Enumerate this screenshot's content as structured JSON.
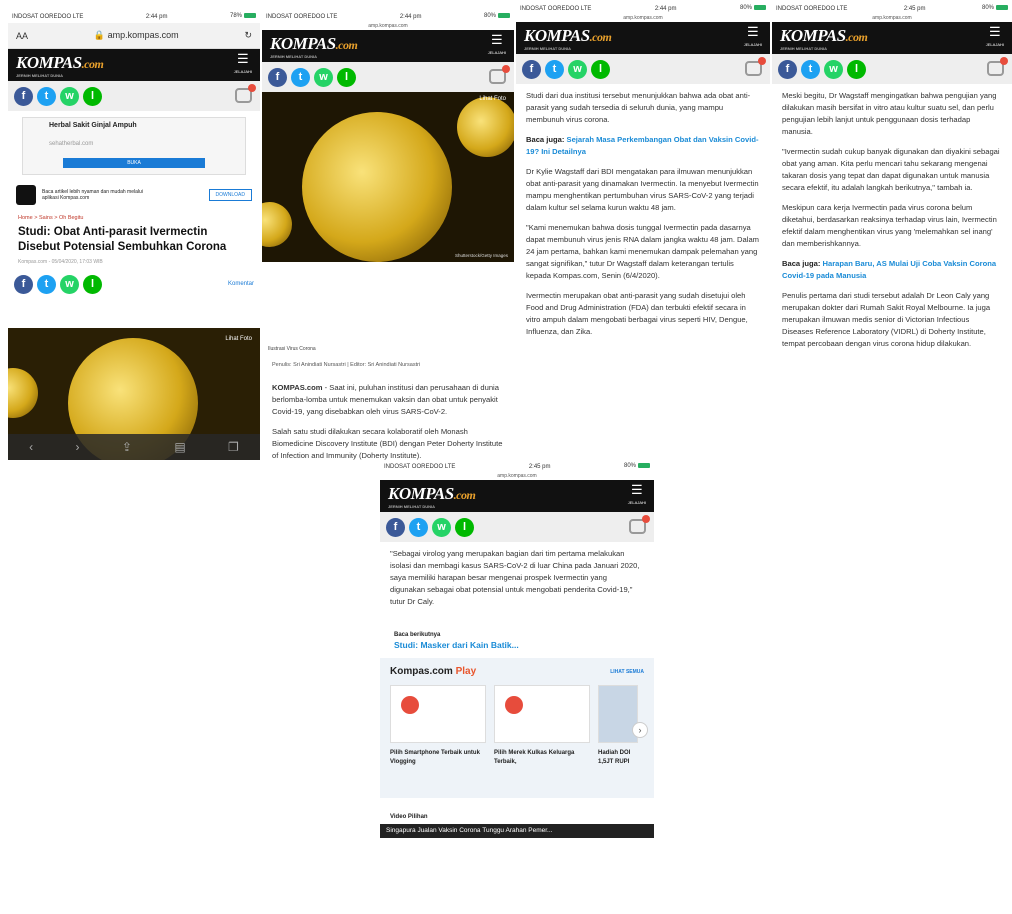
{
  "status": {
    "s1": {
      "carrier": "INDOSAT OOREDOO",
      "net": "LTE",
      "time": "2:44 pm",
      "battery": "78%"
    },
    "s2": {
      "carrier": "INDOSAT OOREDOO",
      "net": "LTE",
      "time": "2:44 pm",
      "battery": "80%"
    },
    "s3": {
      "carrier": "INDOSAT OOREDOO",
      "net": "LTE",
      "time": "2:44 pm",
      "battery": "80%"
    },
    "s4": {
      "carrier": "INDOSAT OOREDOO",
      "net": "LTE",
      "time": "2:45 pm",
      "battery": "80%"
    },
    "s5": {
      "carrier": "INDOSAT OOREDOO",
      "net": "LTE",
      "time": "2:45 pm",
      "battery": "80%"
    }
  },
  "browser": {
    "aa": "AA",
    "url": "amp.kompas.com",
    "reload": "↻"
  },
  "brand": {
    "logo": "KOMPAS",
    "dotcom": ".com",
    "tagline": "JERNIH MELIHAT DUNIA",
    "menu_label": "JELAJAHI"
  },
  "share": {
    "fb": "f",
    "tw": "t",
    "wa": "w",
    "ln": "l"
  },
  "ad": {
    "title": "Herbal Sakit Ginjal Ampuh",
    "url": "sehatherbal.com",
    "button": "BUKA"
  },
  "notice": {
    "text": "Baca artikel lebih nyaman dan mudah melalui aplikasi Kompas.com",
    "button": "DOWNLOAD"
  },
  "article": {
    "crumb": "Home > Sains > Oh Begitu",
    "title": "Studi: Obat Anti-parasit Ivermectin Disebut Potensial Sembuhkan Corona",
    "meta": "Kompas.com - 05/04/2020, 17:03 WIB",
    "komentar": "Komentar",
    "lihat_foto": "Lihat Foto",
    "caption": "Ilustrasi Virus Corona",
    "credit": "Shutterstock/Getty Images",
    "author": "Penulis: Sri Anindiati Nursastri | Editor: Sri Anindiati Nursastri",
    "p1_brand": "KOMPAS.com",
    "p1": " - Saat ini, puluhan institusi dan perusahaan di dunia berlomba-lomba untuk menemukan vaksin dan obat untuk penyakit Covid-19, yang disebabkan oleh virus SARS-CoV-2.",
    "p2": "Salah satu studi dilakukan secara kolaboratif oleh Monash Biomedicine Discovery Institute (BDI) dengan Peter Doherty Institute of Infection and Immunity (Doherty Institute).",
    "p3": "Studi dari dua institusi tersebut menunjukkan bahwa ada obat anti-parasit yang sudah tersedia di seluruh dunia, yang mampu membunuh virus corona.",
    "baca1_label": "Baca juga: ",
    "baca1": "Sejarah Masa Perkembangan Obat dan Vaksin Covid-19? Ini Detailnya",
    "p4": "Dr Kylie Wagstaff dari BDI mengatakan para ilmuwan menunjukkan obat anti-parasit yang dinamakan Ivermectin. Ia menyebut Ivermectin mampu menghentikan pertumbuhan virus SARS-CoV-2 yang terjadi dalam kultur sel selama kurun waktu 48 jam.",
    "p5": "\"Kami menemukan bahwa dosis tunggal Ivermectin pada dasarnya dapat membunuh virus jenis RNA dalam jangka waktu 48 jam. Dalam 24 jam pertama, bahkan kami menemukan dampak pelemahan yang sangat signifikan,\" tutur Dr Wagstaff dalam keterangan tertulis kepada Kompas.com, Senin (6/4/2020).",
    "p6": "Ivermectin merupakan obat anti-parasit yang sudah disetujui oleh Food and Drug Administration (FDA) dan terbukti efektif secara in vitro ampuh dalam mengobati berbagai virus seperti HIV, Dengue, Influenza, dan Zika.",
    "p7": "Meski begitu, Dr Wagstaff mengingatkan bahwa pengujian yang dilakukan masih bersifat in vitro atau kultur suatu sel, dan perlu pengujian lebih lanjut untuk penggunaan dosis terhadap manusia.",
    "p8": "\"Ivermectin sudah cukup banyak digunakan dan diyakini sebagai obat yang aman. Kita perlu mencari tahu sekarang mengenai takaran dosis yang tepat dan dapat digunakan untuk manusia secara efektif, itu adalah langkah berikutnya,\" tambah ia.",
    "p9": "Meskipun cara kerja Ivermectin pada virus corona belum diketahui, berdasarkan reaksinya terhadap virus lain, Ivermectin efektif dalam menghentikan virus yang 'melemahkan sel inang' dan memberishkannya.",
    "baca2_label": "Baca juga: ",
    "baca2": "Harapan Baru, AS Mulai Uji Coba Vaksin Corona Covid-19 pada Manusia",
    "p10": "Penulis pertama dari studi tersebut adalah Dr Leon Caly yang merupakan dokter dari Rumah Sakit Royal Melbourne. Ia juga merupakan ilmuwan medis senior di Victorian Infectious Diseases Reference Laboratory (VIDRL) di Doherty Institute, tempat percobaan dengan virus corona hidup dilakukan.",
    "p11": "\"Sebagai virolog yang merupakan bagian dari tim pertama melakukan isolasi dan membagi kasus SARS-CoV-2 di luar China pada Januari 2020, saya memiliki harapan besar mengenai prospek Ivermectin yang digunakan sebagai obat potensial untuk mengobati penderita Covid-19,\" tutur Dr Caly.",
    "next_label": "Baca berikutnya",
    "next": "Studi: Masker dari Kain Batik..."
  },
  "play": {
    "brand": "Kompas.com",
    "word": "Play",
    "all": "LIHAT SEMUA",
    "cards": [
      {
        "title": "Pilih Smartphone Terbaik untuk Vlogging"
      },
      {
        "title": "Pilih Merek Kulkas Keluarga Terbaik,"
      },
      {
        "title": "Hadiah DOI 1,5JT RUPI"
      }
    ]
  },
  "video": {
    "label": "Video Pilihan",
    "title": "Singapura Jualan Vaksin Corona Tunggu Arahan Pemer..."
  }
}
